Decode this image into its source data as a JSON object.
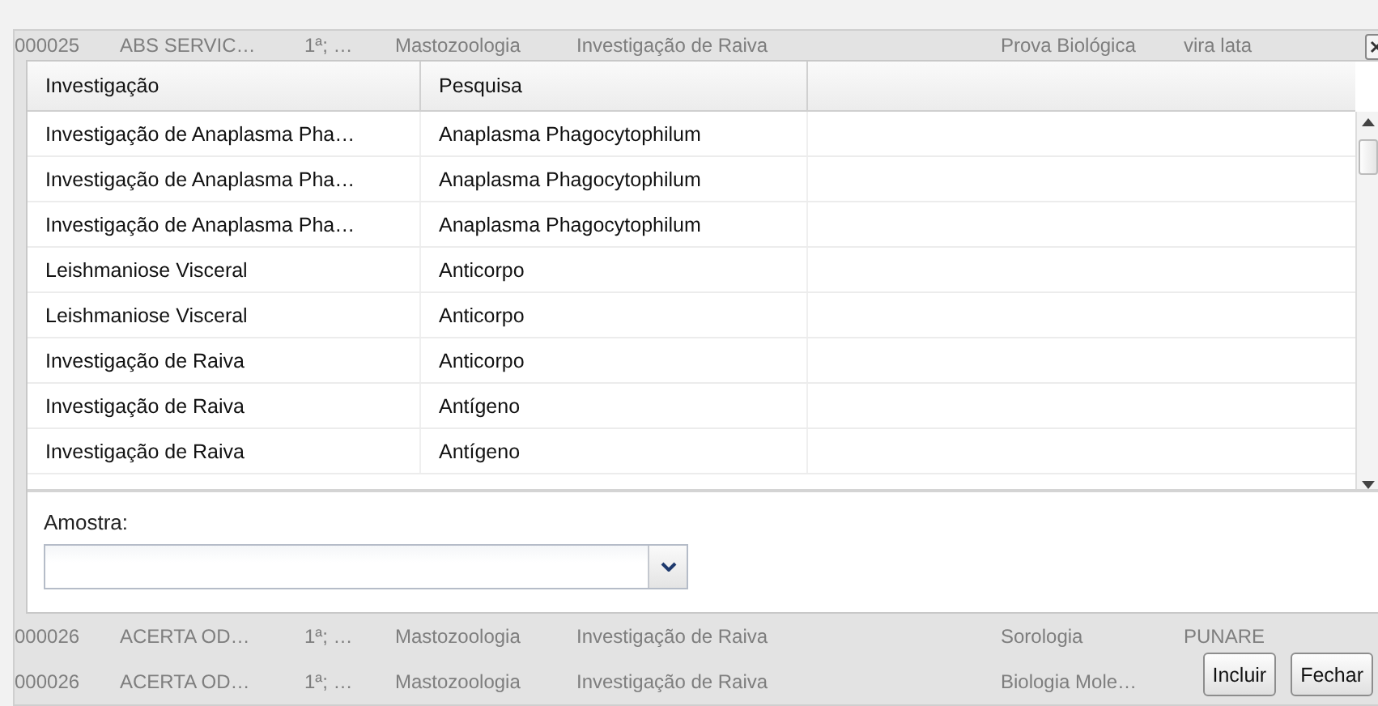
{
  "background_rows_top": [
    {
      "column_1": "000025",
      "column_2": "ABS SERVIC…",
      "column_3": "1ª; …",
      "column_4": "Mastozoologia",
      "column_5": "Investigação de Raiva",
      "column_6": "Prova Biológica",
      "column_7": "vira lata"
    }
  ],
  "table": {
    "columns": [
      "Investigação",
      "Pesquisa"
    ],
    "rows": [
      [
        "Investigação de Anaplasma Pha…",
        "Anaplasma Phagocytophilum"
      ],
      [
        "Investigação de Anaplasma Pha…",
        "Anaplasma Phagocytophilum"
      ],
      [
        "Investigação de Anaplasma Pha…",
        "Anaplasma Phagocytophilum"
      ],
      [
        "Leishmaniose Visceral",
        "Anticorpo"
      ],
      [
        "Leishmaniose Visceral",
        "Anticorpo"
      ],
      [
        "Investigação de Raiva",
        "Anticorpo"
      ],
      [
        "Investigação de Raiva",
        "Antígeno"
      ],
      [
        "Investigação de Raiva",
        "Antígeno"
      ]
    ]
  },
  "amostra": {
    "label": "Amostra:"
  },
  "background_rows_bottom": [
    {
      "column_1": "000026",
      "column_2": "ACERTA OD…",
      "column_3": "1ª; …",
      "column_4": "Mastozoologia",
      "column_5": "Investigação de Raiva",
      "column_6": "Sorologia",
      "column_7": "PUNARE"
    },
    {
      "column_1": "000026",
      "column_2": "ACERTA OD…",
      "column_3": "1ª; …",
      "column_4": "Mastozoologia",
      "column_5": "Investigação de Raiva",
      "column_6": "Biologia Mole…"
    }
  ],
  "buttons": [
    "Incluir",
    "Fechar"
  ]
}
